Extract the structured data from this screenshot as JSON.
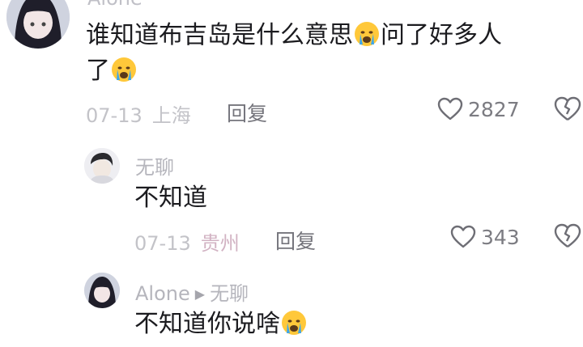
{
  "comments": [
    {
      "author": "Alone",
      "text_before_emoji": "谁知道布吉岛是什么意思",
      "text_after_emoji": "问了好多人",
      "text_line2": "了",
      "date": "07-13",
      "location": "上海",
      "reply_label": "回复",
      "likes": "2827"
    },
    {
      "author": "无聊",
      "text": "不知道",
      "date": "07-13",
      "location": "贵州",
      "reply_label": "回复",
      "likes": "343"
    },
    {
      "author": "Alone",
      "reply_to": "无聊",
      "text": "不知道你说啥"
    }
  ],
  "icons": {
    "like": "heart-outline-icon",
    "dislike": "broken-heart-icon",
    "emoji": "crying-face-emoji",
    "arrow": "reply-arrow-icon"
  },
  "colors": {
    "accent_location": "#d2b3c3",
    "meta_gray": "#c3c3c8"
  }
}
